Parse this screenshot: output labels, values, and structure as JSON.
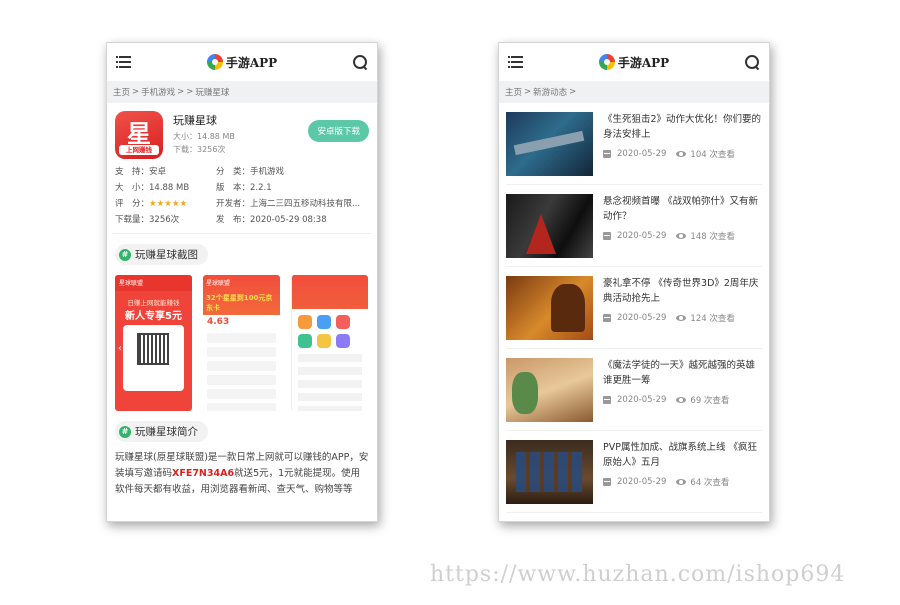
{
  "left_page": {
    "header": {
      "logo_text": "手游APP"
    },
    "breadcrumb": [
      "主页",
      ">",
      "手机游戏",
      ">",
      ">",
      "玩赚星球"
    ],
    "app": {
      "icon_glyph": "星",
      "icon_band": "上网赚钱",
      "name": "玩赚星球",
      "size_line": "大小：14.88 MB",
      "downloads_line": "下载：3256次",
      "download_button": "安卓版下载"
    },
    "details": [
      "支　持：安卓",
      "分　类：手机游戏",
      "大　小：14.88 MB",
      "版　本：2.2.1",
      "评　分：",
      "开发者：上海二三四五移动科技有限...",
      "下载量：3256次",
      "发　布：2020-05-29 08:38"
    ],
    "rating_stars": "★★★★★",
    "screenshots_title": "玩赚星球截图",
    "screenshots": {
      "s1_top": "星球联盟",
      "s1_line1": "日赚上网就能赚钱",
      "s1_line2": "新人专享5元",
      "s2_top": "星球联盟",
      "s2_big": "32个星星到100元京东卡",
      "s2_num": "4.63"
    },
    "intro_title": "玩赚星球简介",
    "description_part1": "玩赚星球(原星球联盟)是一款日常上网就可以赚钱的APP，安装填写邀请码",
    "invite_code": "XFE7N34A6",
    "description_part2": "就送5元，1元就能提现。使用软件每天都有收益，用浏览器看新闻、查天气、购物等等"
  },
  "right_page": {
    "header": {
      "logo_text": "手游APP"
    },
    "breadcrumb": [
      "主页",
      ">",
      "新游动态",
      ">"
    ],
    "news": [
      {
        "title": "《生死狙击2》动作大优化！你们要的身法安排上",
        "date": "2020-05-29",
        "views": "104 次查看"
      },
      {
        "title": "悬念视频首曝 《战双帕弥什》又有新动作？",
        "date": "2020-05-29",
        "views": "148 次查看"
      },
      {
        "title": "豪礼拿不停 《传奇世界3D》2周年庆典活动抢先上",
        "date": "2020-05-29",
        "views": "124 次查看"
      },
      {
        "title": "《魔法学徒的一天》越死越强的英雄谁更胜一筹",
        "date": "2020-05-29",
        "views": "69 次查看"
      },
      {
        "title": "PVP属性加成、战旗系统上线 《疯狂原始人》五月",
        "date": "2020-05-29",
        "views": "64 次查看"
      }
    ]
  },
  "watermark": "https://www.huzhan.com/ishop694",
  "colors": {
    "accent_green": "#5bc9a7",
    "tag_green": "#34b36a",
    "invite_red": "#e02020",
    "star_orange": "#f5a623"
  }
}
